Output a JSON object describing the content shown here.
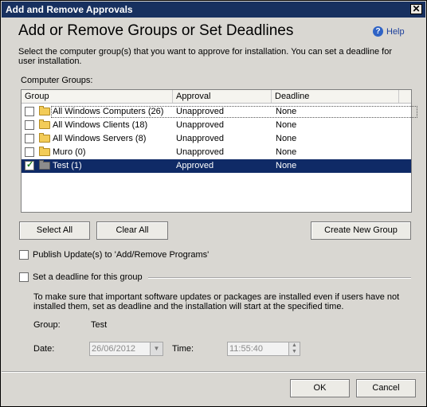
{
  "window": {
    "title": "Add and Remove Approvals",
    "close_glyph": "✕"
  },
  "heading": "Add or Remove Groups or Set Deadlines",
  "help": {
    "label": "Help",
    "icon": "?"
  },
  "instructions": "Select the computer group(s) that you want to approve for installation. You can set a deadline for user installation.",
  "groups_label": "Computer Groups:",
  "table": {
    "columns": [
      "Group",
      "Approval",
      "Deadline"
    ],
    "rows": [
      {
        "group": "All Windows Computers  (26)",
        "approval": "Unapproved",
        "deadline": "None",
        "checked": false,
        "selected": false
      },
      {
        "group": "All Windows Clients  (18)",
        "approval": "Unapproved",
        "deadline": "None",
        "checked": false,
        "selected": false
      },
      {
        "group": "All Windows Servers  (8)",
        "approval": "Unapproved",
        "deadline": "None",
        "checked": false,
        "selected": false
      },
      {
        "group": "Muro  (0)",
        "approval": "Unapproved",
        "deadline": "None",
        "checked": false,
        "selected": false
      },
      {
        "group": "Test  (1)",
        "approval": "Approved",
        "deadline": "None",
        "checked": true,
        "selected": true
      }
    ]
  },
  "buttons": {
    "select_all": "Select All",
    "clear_all": "Clear All",
    "create_group": "Create New Group",
    "ok": "OK",
    "cancel": "Cancel"
  },
  "publish_checkbox": {
    "label": "Publish Update(s) to 'Add/Remove Programs'",
    "checked": false
  },
  "deadline_checkbox": {
    "label": "Set a deadline for this group",
    "checked": false
  },
  "deadline_info": "To make sure that important software updates or packages are installed even if users have not installed them, set as deadline and the installation will start at the specified time.",
  "group_field": {
    "label": "Group:",
    "value": "Test"
  },
  "date_field": {
    "label": "Date:",
    "value": "26/06/2012"
  },
  "time_field": {
    "label": "Time:",
    "value": "11:55:40"
  }
}
